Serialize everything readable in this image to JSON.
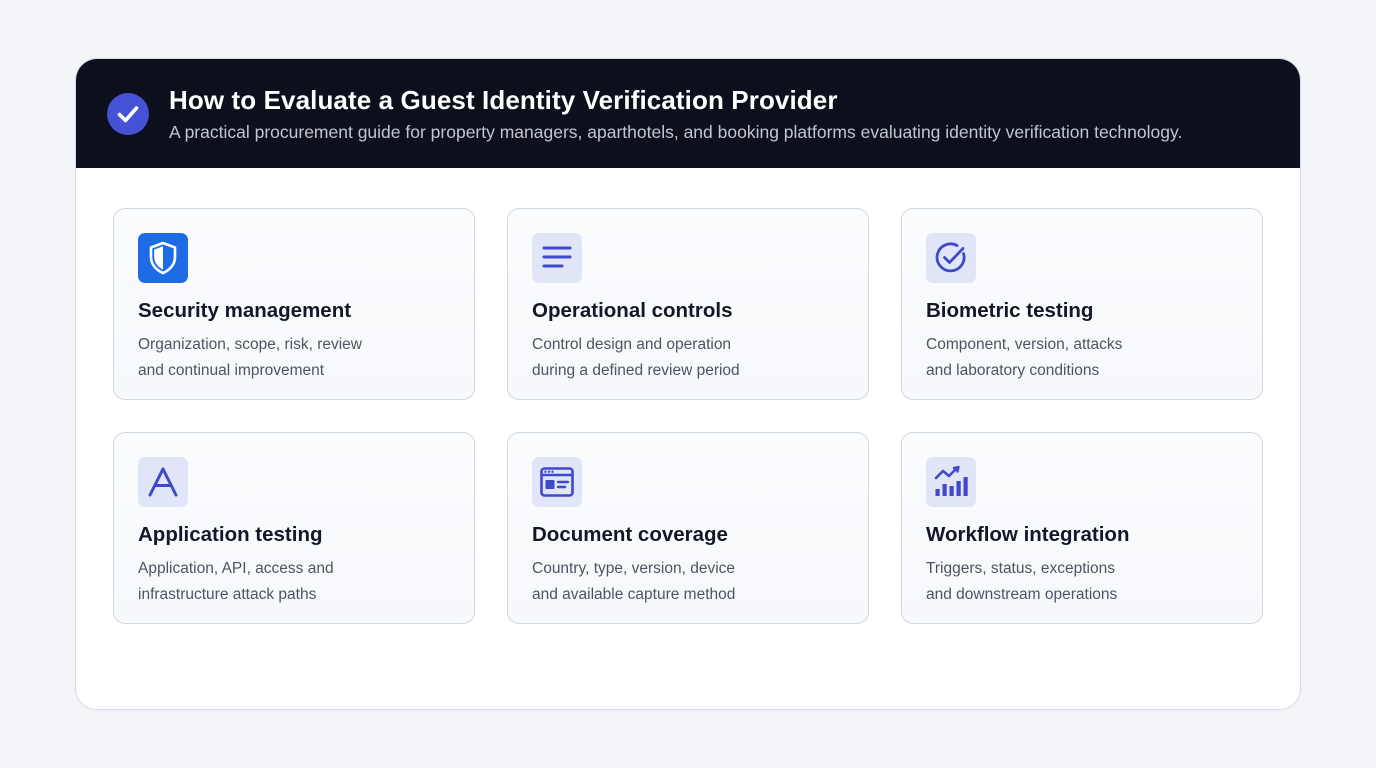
{
  "header": {
    "title": "How to Evaluate a Guest Identity Verification Provider",
    "subtitle": "A practical procurement guide for property managers, aparthotels, and booking platforms evaluating identity verification technology.",
    "icon": "check-circle-icon"
  },
  "colors": {
    "header_bg": "#0b101c",
    "accent": "#4552d6",
    "icon_tile_bg": "#e1e5f8",
    "shield_tile_bg": "#1e6be6",
    "card_border": "#d3d8e2"
  },
  "cards": [
    {
      "icon": "shield-icon",
      "title": "Security management",
      "line1": "Organization, scope, risk, review",
      "line2": "and continual improvement"
    },
    {
      "icon": "list-lines-icon",
      "title": "Operational controls",
      "line1": "Control design and operation",
      "line2": "during a defined review period"
    },
    {
      "icon": "check-circle-outline-icon",
      "title": "Biometric testing",
      "line1": "Component, version, attacks",
      "line2": "and laboratory conditions"
    },
    {
      "icon": "letter-a-icon",
      "title": "Application testing",
      "line1": "Application, API, access and",
      "line2": "infrastructure attack paths"
    },
    {
      "icon": "id-card-window-icon",
      "title": "Document coverage",
      "line1": "Country, type, version, device",
      "line2": "and available capture method"
    },
    {
      "icon": "trend-chart-icon",
      "title": "Workflow integration",
      "line1": "Triggers, status, exceptions",
      "line2": "and downstream operations"
    }
  ]
}
